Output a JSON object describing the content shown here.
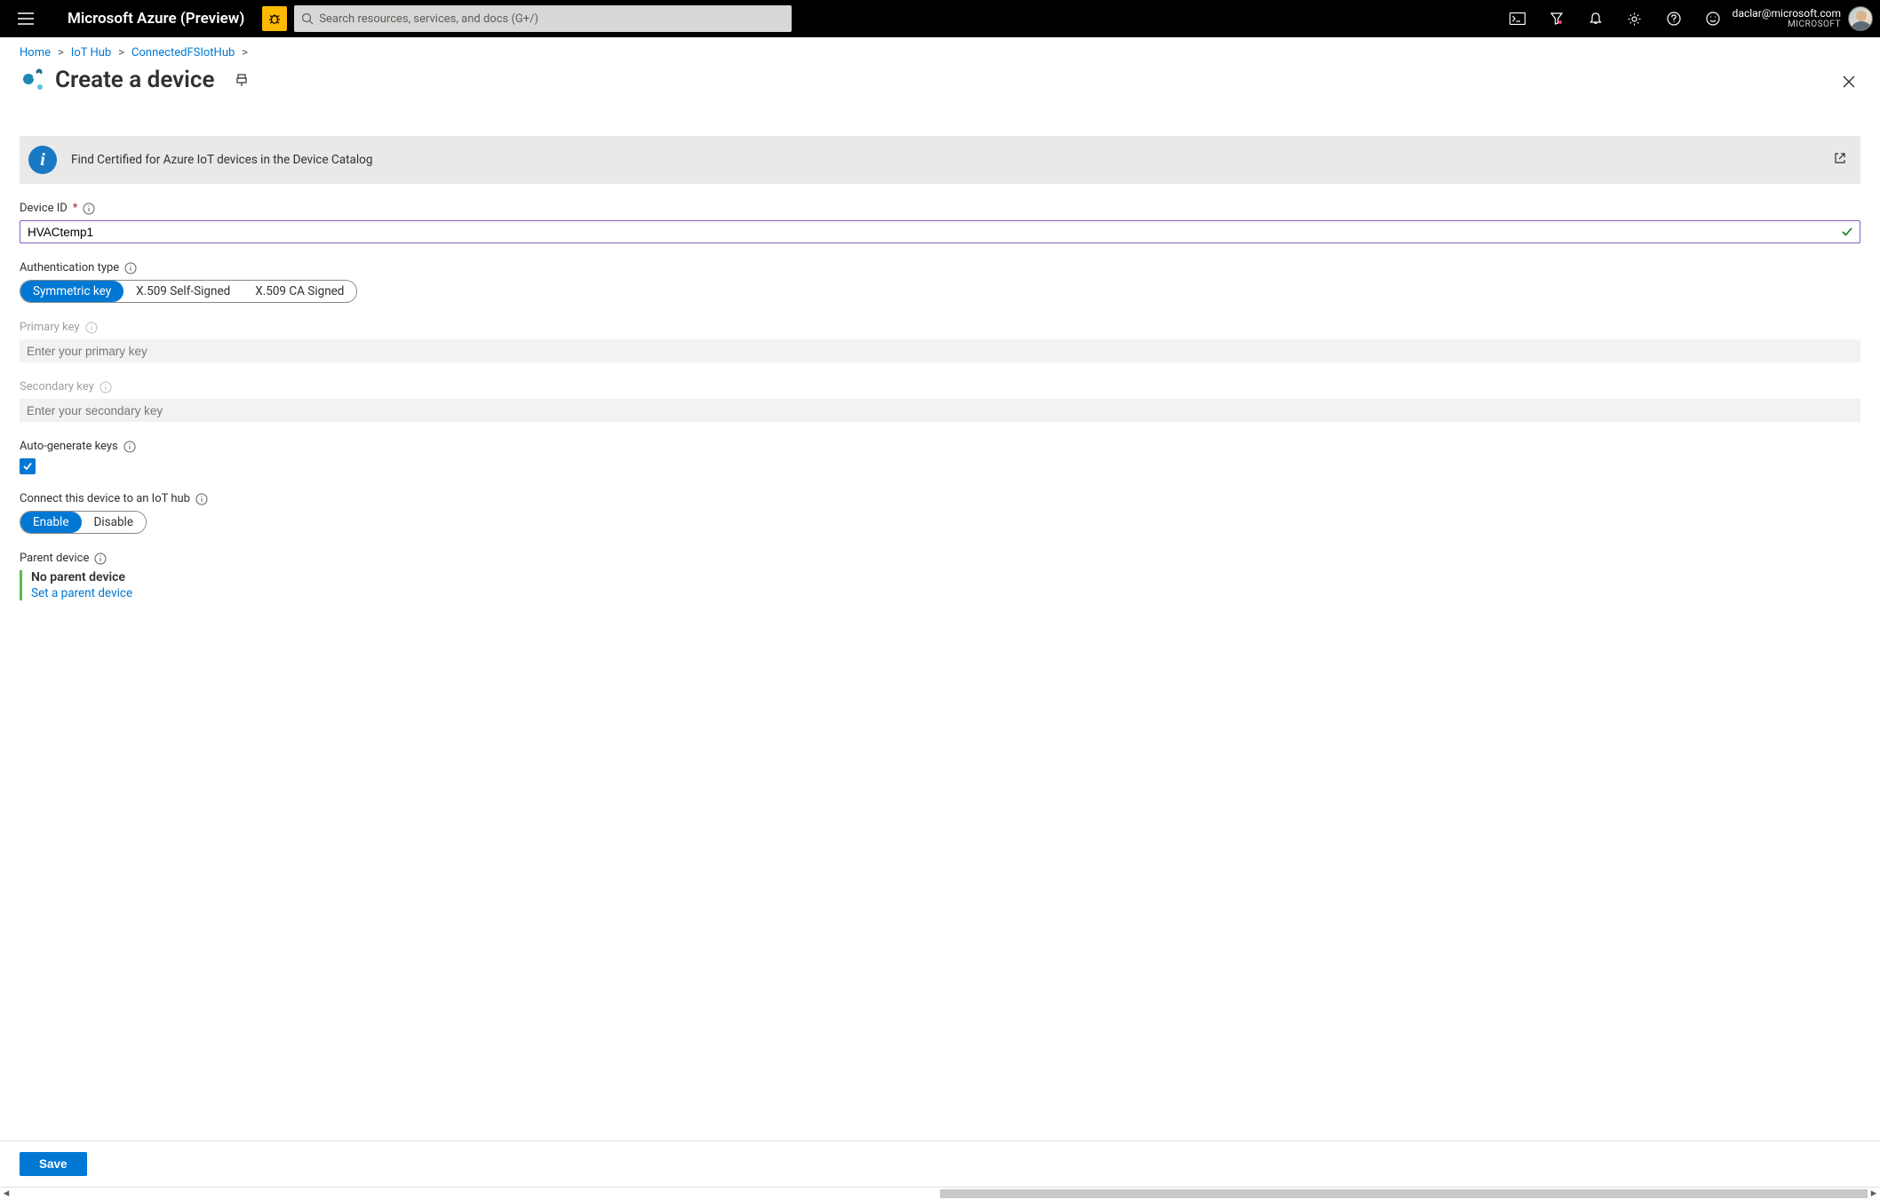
{
  "topbar": {
    "brand": "Microsoft Azure (Preview)",
    "search_placeholder": "Search resources, services, and docs (G+/)",
    "user_email": "daclar@microsoft.com",
    "tenant": "MICROSOFT"
  },
  "breadcrumbs": {
    "items": [
      "Home",
      "IoT Hub",
      "ConnectedFSIotHub"
    ]
  },
  "page": {
    "title": "Create a device"
  },
  "info": {
    "message": "Find Certified for Azure IoT devices in the Device Catalog"
  },
  "form": {
    "device_id_label": "Device ID",
    "device_id_value": "HVACtemp1",
    "auth_type_label": "Authentication type",
    "auth_options": {
      "symmetric": "Symmetric key",
      "x509_self": "X.509 Self-Signed",
      "x509_ca": "X.509 CA Signed"
    },
    "primary_key_label": "Primary key",
    "primary_key_placeholder": "Enter your primary key",
    "secondary_key_label": "Secondary key",
    "secondary_key_placeholder": "Enter your secondary key",
    "auto_gen_label": "Auto-generate keys",
    "connect_label": "Connect this device to an IoT hub",
    "connect_options": {
      "enable": "Enable",
      "disable": "Disable"
    },
    "parent_label": "Parent device",
    "parent_none": "No parent device",
    "parent_set_link": "Set a parent device"
  },
  "footer": {
    "save": "Save"
  }
}
